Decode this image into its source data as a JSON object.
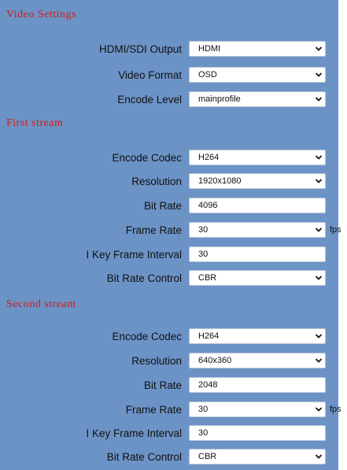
{
  "video_settings": {
    "title": "Video Settings",
    "hdmi_sdi_output": {
      "label": "HDMI/SDI Output",
      "value": "HDMI"
    },
    "video_format": {
      "label": "Video Format",
      "value": "OSD"
    },
    "encode_level": {
      "label": "Encode Level",
      "value": "mainprofile"
    }
  },
  "first_stream": {
    "title": "First stream",
    "encode_codec": {
      "label": "Encode Codec",
      "value": "H264"
    },
    "resolution": {
      "label": "Resolution",
      "value": "1920x1080"
    },
    "bit_rate": {
      "label": "Bit Rate",
      "value": "4096"
    },
    "frame_rate": {
      "label": "Frame Rate",
      "value": "30",
      "unit": "fps"
    },
    "i_key_frame_interval": {
      "label": "I Key Frame Interval",
      "value": "30"
    },
    "bit_rate_control": {
      "label": "Bit Rate Control",
      "value": "CBR"
    }
  },
  "second_stream": {
    "title": "Second stream",
    "encode_codec": {
      "label": "Encode Codec",
      "value": "H264"
    },
    "resolution": {
      "label": "Resolution",
      "value": "640x360"
    },
    "bit_rate": {
      "label": "Bit Rate",
      "value": "2048"
    },
    "frame_rate": {
      "label": "Frame Rate",
      "value": "30",
      "unit": "fps"
    },
    "i_key_frame_interval": {
      "label": "I Key Frame Interval",
      "value": "30"
    },
    "bit_rate_control": {
      "label": "Bit Rate Control",
      "value": "CBR"
    }
  },
  "colors": {
    "panel_background": "#6c93c6",
    "section_title": "#d21a1a",
    "field_background": "#ffffff"
  }
}
